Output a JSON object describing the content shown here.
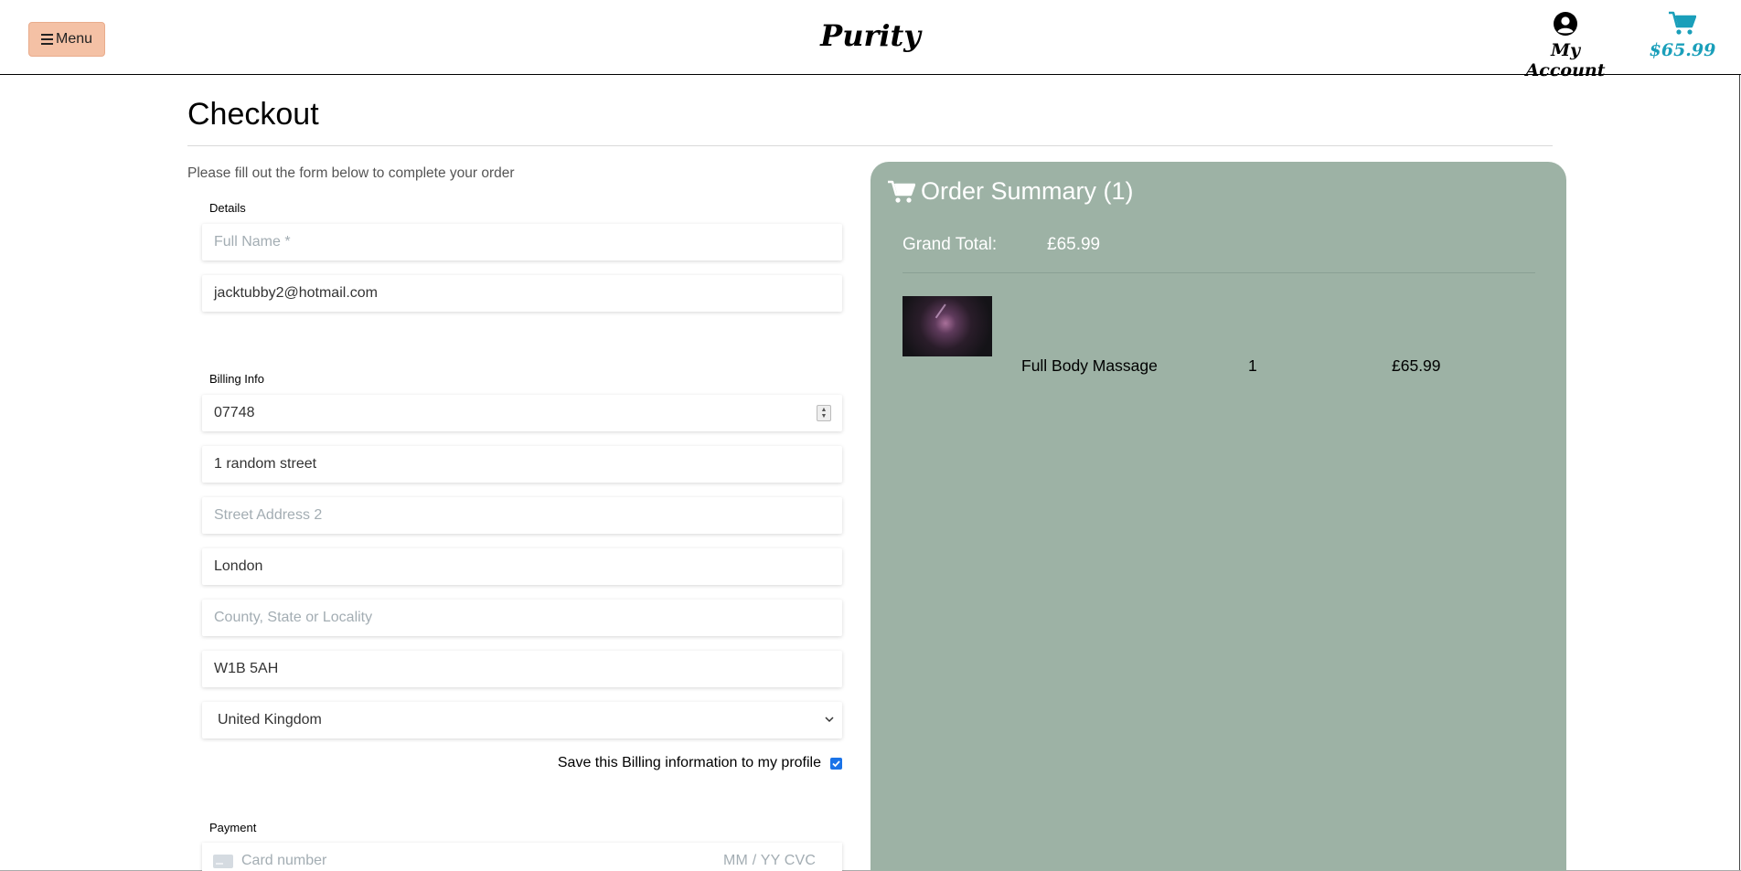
{
  "header": {
    "menu_label": "Menu",
    "brand": "Purity",
    "account_label": "My Account",
    "cart_total": "$65.99"
  },
  "page": {
    "title": "Checkout",
    "intro": "Please fill out the form below to complete your order"
  },
  "details": {
    "label": "Details",
    "full_name_placeholder": "Full Name *",
    "email_value": "jacktubby2@hotmail.com"
  },
  "billing": {
    "label": "Billing Info",
    "phone_value": "07748",
    "street1_value": "1 random street",
    "street2_placeholder": "Street Address 2",
    "city_value": "London",
    "county_placeholder": "County, State or Locality",
    "postcode_value": "W1B 5AH",
    "country_selected": "United Kingdom",
    "save_label": "Save this Billing information to my profile",
    "save_checked": true
  },
  "payment": {
    "label": "Payment",
    "card_placeholder": "Card number",
    "expiry_cvc_placeholder": "MM / YY  CVC"
  },
  "summary": {
    "title": "Order Summary (1)",
    "grand_total_label": "Grand Total:",
    "grand_total_value": "£65.99",
    "items": [
      {
        "name": "Full Body Massage",
        "quantity": "1",
        "price": "£65.99"
      }
    ]
  },
  "colors": {
    "menu_bg": "#f4c1a5",
    "cart_accent": "#1a9fba",
    "summary_bg": "#9db2a5",
    "checkbox": "#1a73e8"
  }
}
